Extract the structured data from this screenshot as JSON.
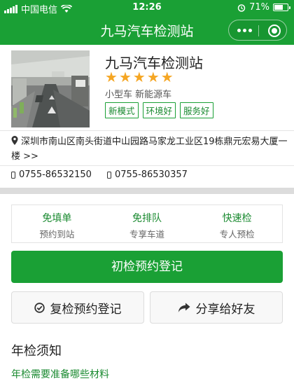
{
  "status_bar": {
    "carrier": "中国电信",
    "time": "12:26",
    "battery_percent": "71%",
    "battery_level": 0.71,
    "icons": [
      "signal-icon",
      "wifi-icon",
      "alarm-icon",
      "battery-icon"
    ]
  },
  "nav": {
    "title": "九马汽车检测站",
    "more_icon": "more-dots-icon",
    "close_icon": "miniprogram-close-icon"
  },
  "station": {
    "name": "九马汽车检测站",
    "rating": 5,
    "rating_max": 5,
    "car_types": "小型车 新能源车",
    "tags": [
      "新模式",
      "环境好",
      "服务好"
    ],
    "address": "深圳市南山区南头街道中山园路马家龙工业区19栋鼎元宏易大厦一楼 >>",
    "phones": [
      "0755-86532150",
      "0755-86530357"
    ]
  },
  "features": [
    {
      "title": "免填单",
      "subtitle": "预约到站"
    },
    {
      "title": "免排队",
      "subtitle": "专享车道"
    },
    {
      "title": "快速检",
      "subtitle": "专人预检"
    }
  ],
  "actions": {
    "primary": "初检预约登记",
    "recheck": "复检预约登记",
    "share": "分享给好友"
  },
  "notice": {
    "title": "年检须知",
    "link": "年检需要准备哪些材料"
  },
  "colors": {
    "brand_green": "#1aa035",
    "star_orange": "#f5a623",
    "divider_band": "#dcdcdc"
  }
}
